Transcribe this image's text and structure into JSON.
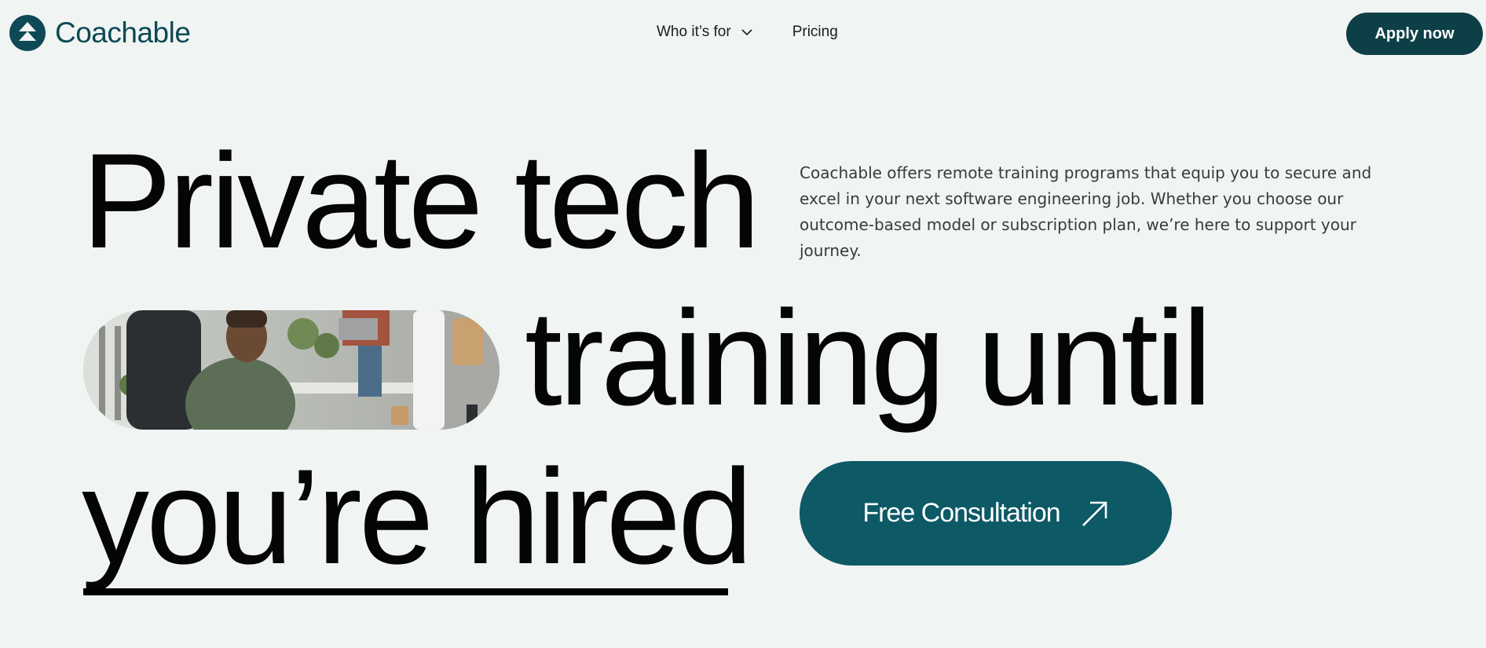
{
  "header": {
    "logo_text": "Coachable",
    "nav": [
      {
        "label": "Who it’s for",
        "has_dropdown": true
      },
      {
        "label": "Pricing",
        "has_dropdown": false
      }
    ],
    "apply_label": "Apply now"
  },
  "hero": {
    "line1": "Private tech",
    "line2": "training until",
    "line3": "you’re hired",
    "intro": "Coachable offers remote training programs that equip you to secure and excel in your next software engineering job. Whether you choose our outcome-based model or subscription plan, we’re here to support your journey.",
    "cta_label": "Free Consultation"
  },
  "icons": {
    "logo": "coachable-logo-icon",
    "dropdown": "chevron-down-icon",
    "cta": "arrow-up-right-icon"
  },
  "colors": {
    "background": "#f0f4f3",
    "brand_dark": "#0d3f47",
    "cta": "#0d5966",
    "logo_text": "#0d4a55"
  }
}
